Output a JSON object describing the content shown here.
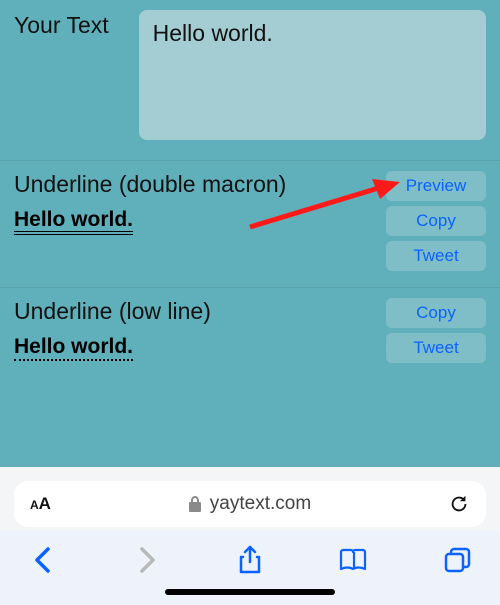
{
  "input": {
    "label": "Your Text",
    "value": "Hello world."
  },
  "styles": [
    {
      "title": "Underline (double macron)",
      "output": "Hello world.  ",
      "buttons": [
        "Preview",
        "Copy",
        "Tweet"
      ],
      "decor": "double"
    },
    {
      "title": "Underline (low line)",
      "output": "Hello world.  ",
      "buttons": [
        "Copy",
        "Tweet"
      ],
      "decor": "dotted"
    }
  ],
  "browser": {
    "aa": "AA",
    "domain": "yaytext.com"
  }
}
